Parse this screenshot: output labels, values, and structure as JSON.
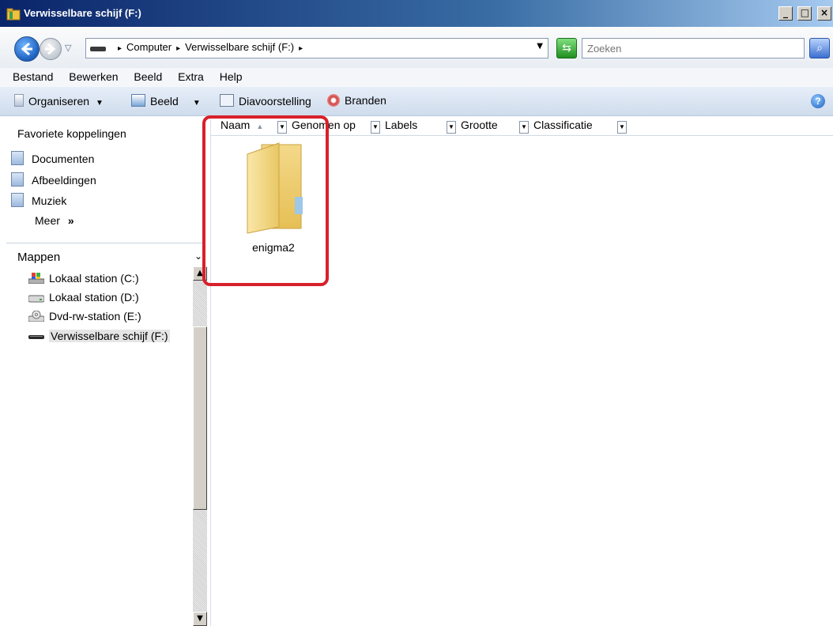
{
  "window": {
    "title": "Verwisselbare schijf (F:)",
    "buttons": {
      "minimize": "_",
      "maximize": "□",
      "close": "×"
    }
  },
  "address": {
    "breadcrumbs": [
      "Computer",
      "Verwisselbare schijf (F:)"
    ],
    "search_placeholder": "Zoeken"
  },
  "menu": [
    "Bestand",
    "Bewerken",
    "Beeld",
    "Extra",
    "Help"
  ],
  "toolbar": {
    "organize": "Organiseren",
    "view": "Beeld",
    "slideshow": "Diavoorstelling",
    "burn": "Branden"
  },
  "favorites": {
    "title": "Favoriete koppelingen",
    "items": [
      "Documenten",
      "Afbeeldingen",
      "Muziek"
    ],
    "more": "Meer",
    "more_chevron": "»"
  },
  "folders": {
    "title": "Mappen",
    "items": [
      {
        "label": "Lokaal station (C:)",
        "icon": "os-drive-icon"
      },
      {
        "label": "Lokaal station (D:)",
        "icon": "hard-drive-icon"
      },
      {
        "label": "Dvd-rw-station (E:)",
        "icon": "dvd-drive-icon"
      },
      {
        "label": "Verwisselbare schijf (F:)",
        "icon": "removable-drive-icon",
        "selected": true
      }
    ]
  },
  "columns": [
    "Naam",
    "Genomen op",
    "Labels",
    "Grootte",
    "Classificatie"
  ],
  "files": [
    {
      "name": "enigma2",
      "type": "folder"
    }
  ],
  "colors": {
    "highlight": "#d8202a",
    "title_bar": "#0a246a"
  }
}
